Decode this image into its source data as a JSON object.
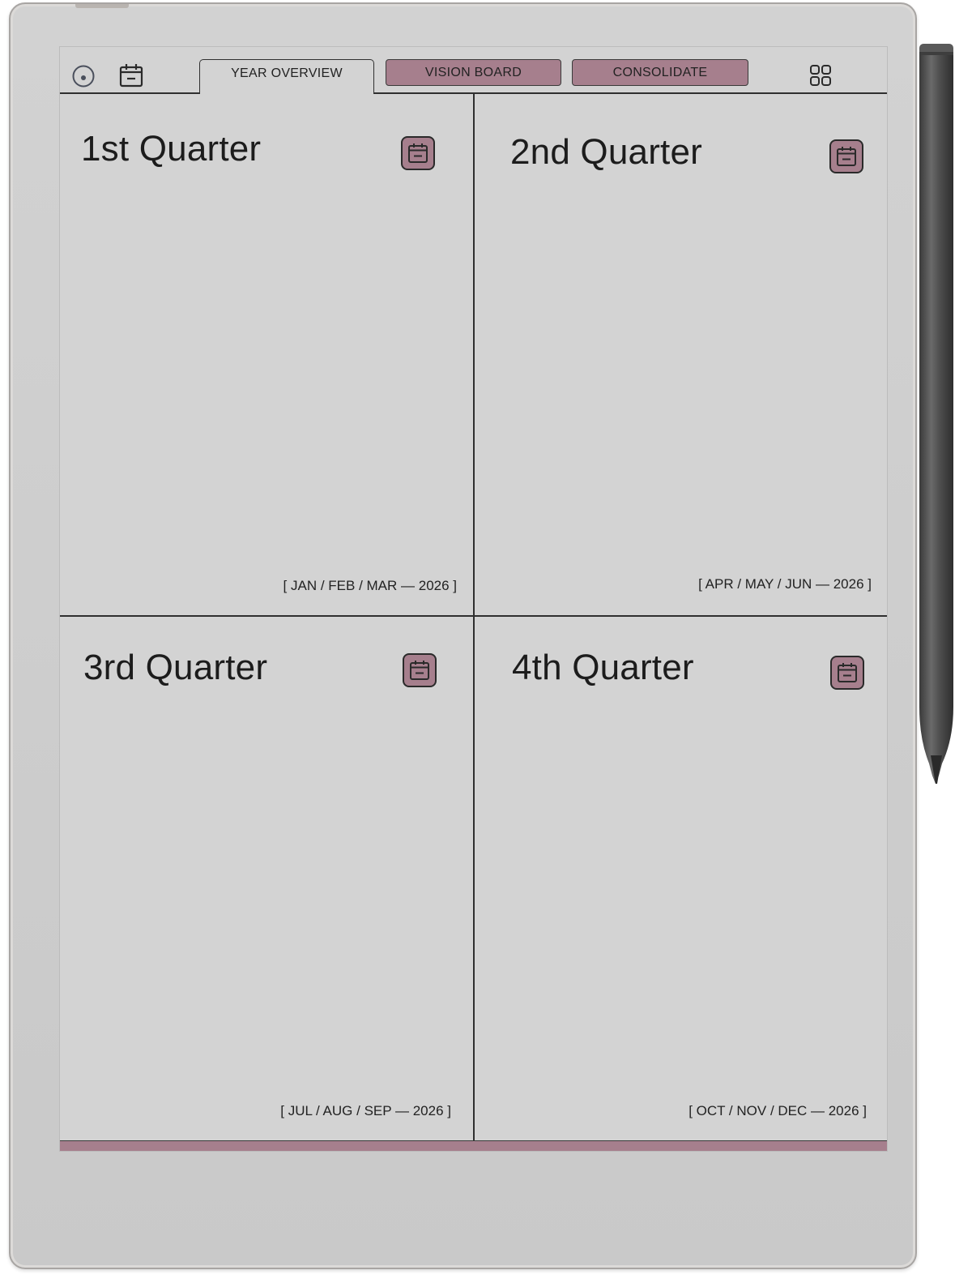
{
  "toolbar": {
    "tabs": [
      {
        "label": "YEAR OVERVIEW",
        "active": true
      },
      {
        "label": "VISION BOARD",
        "active": false
      },
      {
        "label": "CONSOLIDATE",
        "active": false
      }
    ],
    "left_icons": [
      "record-icon",
      "calendar-icon"
    ],
    "right_icon": "grid-icon"
  },
  "quarters": [
    {
      "title": "1st Quarter",
      "range": "[ JAN / FEB / MAR — 2026 ]"
    },
    {
      "title": "2nd Quarter",
      "range": "[ APR / MAY / JUN — 2026 ]"
    },
    {
      "title": "3rd Quarter",
      "range": "[ JUL / AUG / SEP — 2026 ]"
    },
    {
      "title": "4th Quarter",
      "range": "[ OCT / NOV / DEC — 2026 ]"
    }
  ],
  "colors": {
    "accent": "#a67f8d",
    "screen": "#d3d3d3",
    "ink": "#2f2f2f"
  }
}
